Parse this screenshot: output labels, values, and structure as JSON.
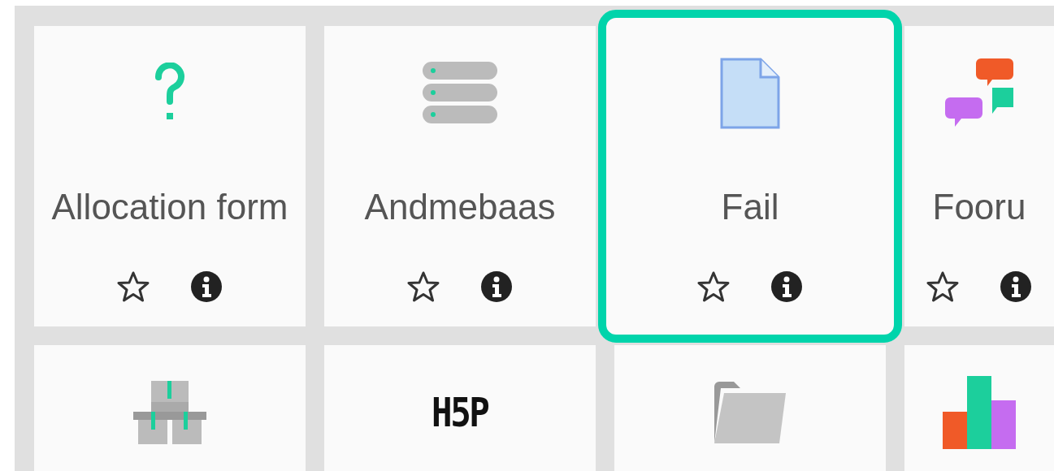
{
  "activities": [
    {
      "kind": "question",
      "name": "Allocation form",
      "selected": false
    },
    {
      "kind": "database",
      "name": "Andmebaas",
      "selected": false
    },
    {
      "kind": "file",
      "name": "Fail",
      "selected": true
    },
    {
      "kind": "forum",
      "name": "Fooru",
      "selected": false
    },
    {
      "kind": "boxes",
      "selected": false
    },
    {
      "kind": "logo",
      "logo_text": "H5P",
      "selected": false
    },
    {
      "kind": "folder",
      "selected": false
    },
    {
      "kind": "chart",
      "selected": false
    }
  ]
}
